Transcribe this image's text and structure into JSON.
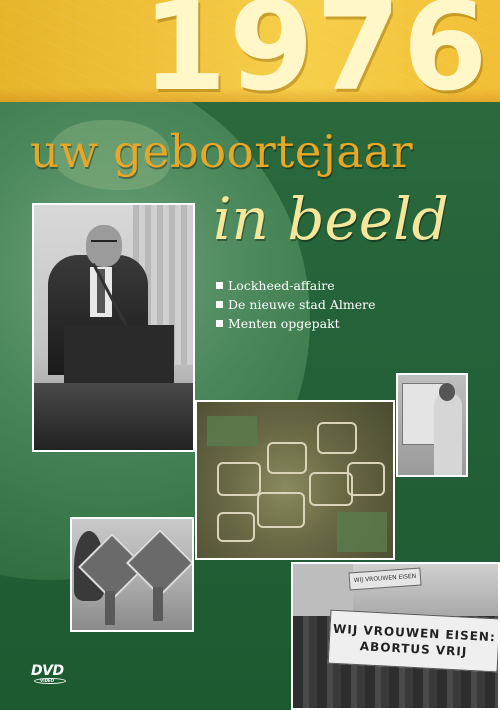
{
  "cover": {
    "year": "1976",
    "title_line1": "uw geboortejaar",
    "title_line2": "in beeld",
    "bullets": [
      "Lockheed-affaire",
      "De nieuwe stad Almere",
      "Menten opgepakt"
    ],
    "protest_banner_line1": "WIJ VROUWEN EISEN:",
    "protest_banner_line2": "ABORTUS VRIJ",
    "protest_banner_small": "WIJ VROUWEN EISEN",
    "dvd_logo": "DVD",
    "dvd_logo_sub": "VIDEO"
  },
  "colors": {
    "background_green": "#25633a",
    "top_band_yellow": "#f0c03a",
    "year_text": "#fff7c8",
    "title_orange": "#e8a726",
    "title_cream": "#f4e69a"
  },
  "icons": [
    "dvd-video-logo"
  ]
}
